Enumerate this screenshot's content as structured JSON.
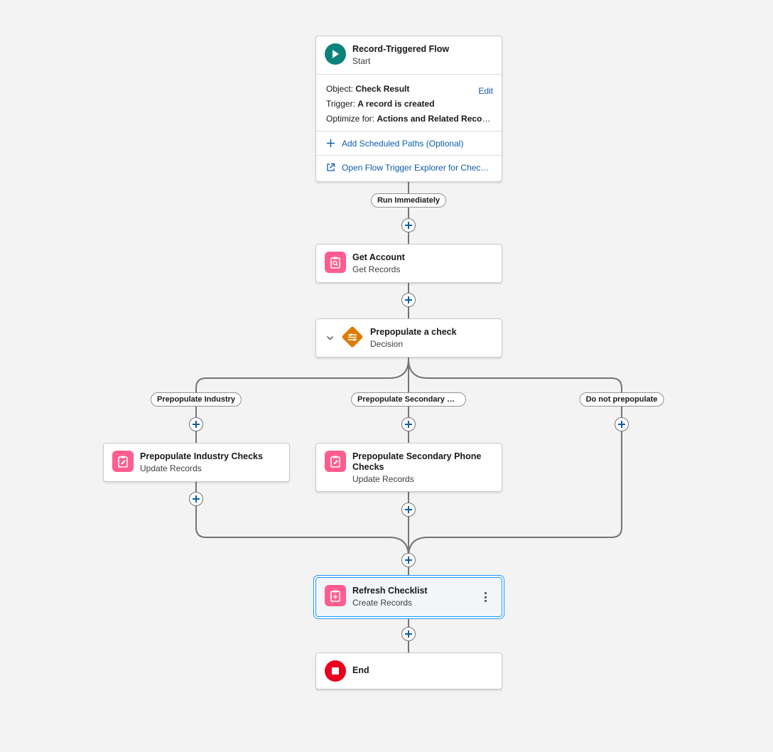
{
  "colors": {
    "link": "#0b5cab",
    "start_icon": "#0b827c",
    "records_icon": "#ff5d8f",
    "decision_icon": "#dd7a01",
    "end_icon": "#ea001e",
    "selected_border": "#1b96ff"
  },
  "start": {
    "title": "Record-Triggered Flow",
    "subtitle": "Start",
    "object_label": "Object:",
    "object_value": "Check Result",
    "edit_label": "Edit",
    "trigger_label": "Trigger:",
    "trigger_value": "A record is created",
    "optimize_label": "Optimize for:",
    "optimize_value": "Actions and Related Records",
    "add_paths_label": "Add Scheduled Paths (Optional)",
    "explorer_label": "Open Flow Trigger Explorer for Check Result",
    "icon": "play-icon"
  },
  "run_immediately": "Run Immediately",
  "get_account": {
    "title": "Get Account",
    "subtitle": "Get Records",
    "icon": "get-records-icon"
  },
  "decision": {
    "title": "Prepopulate a check",
    "subtitle": "Decision",
    "icon": "decision-icon"
  },
  "branches": {
    "industry": "Prepopulate Industry",
    "secondary": "Prepopulate Secondary Phone",
    "none": "Do not prepopulate"
  },
  "industry_checks": {
    "title": "Prepopulate Industry Checks",
    "subtitle": "Update Records",
    "icon": "update-records-icon"
  },
  "secondary_checks": {
    "title": "Prepopulate Secondary Phone Checks",
    "subtitle": "Update Records",
    "icon": "update-records-icon"
  },
  "refresh": {
    "title": "Refresh Checklist",
    "subtitle": "Create Records",
    "icon": "create-records-icon"
  },
  "end": {
    "title": "End",
    "icon": "stop-icon"
  }
}
